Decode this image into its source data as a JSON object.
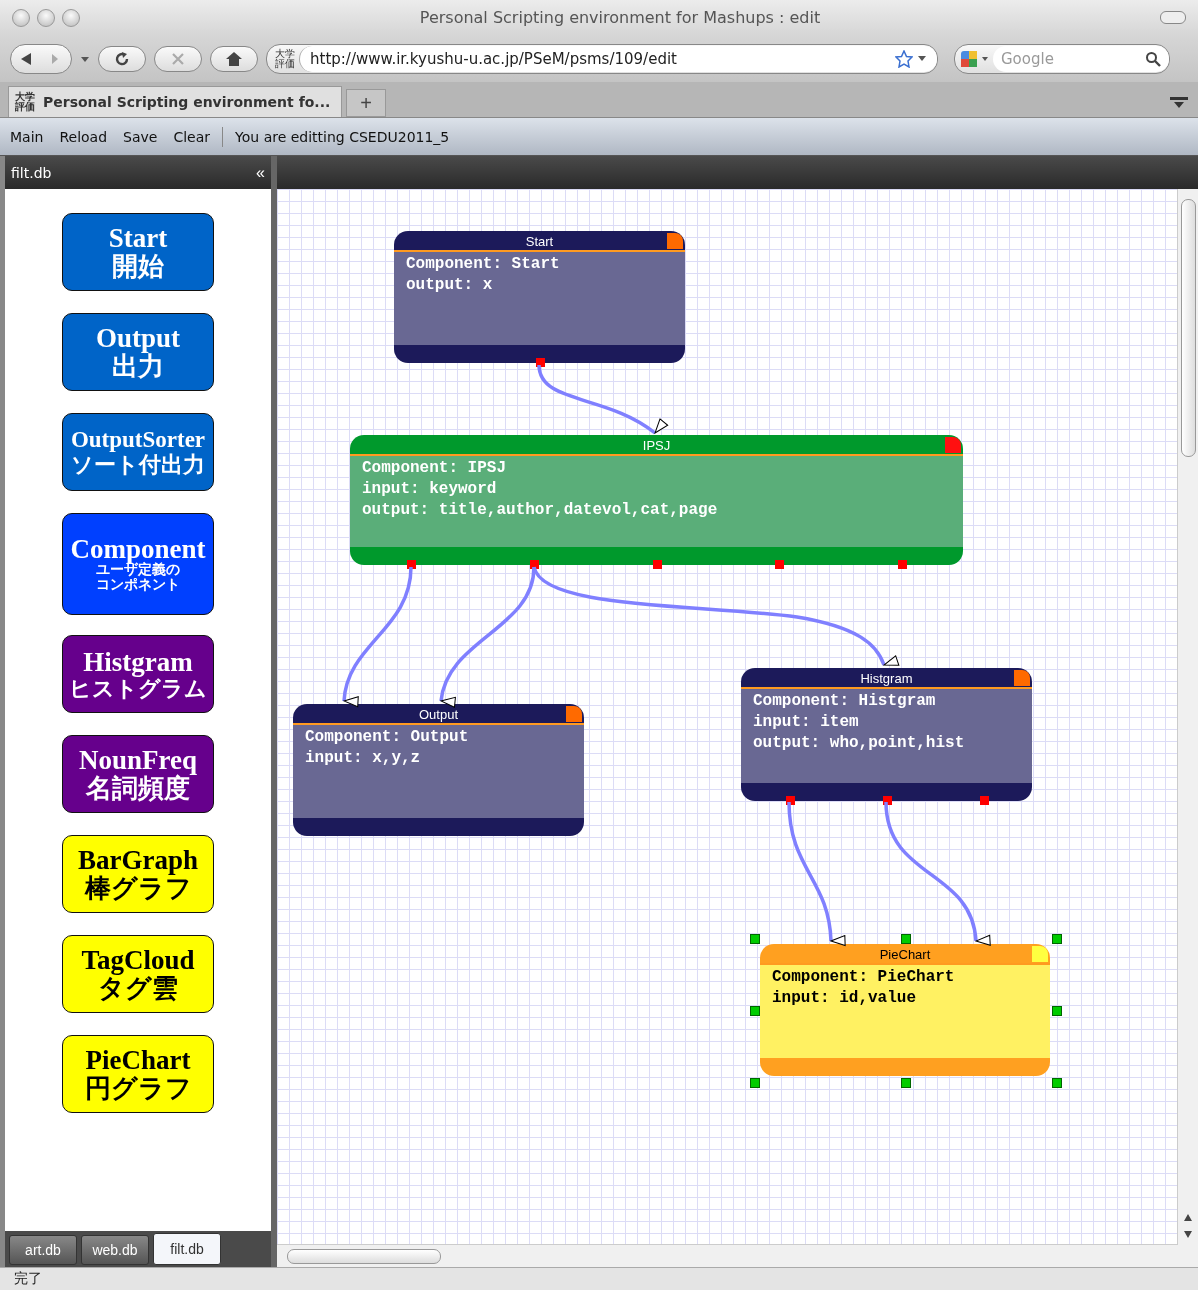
{
  "window": {
    "title": "Personal Scripting environment for Mashups : edit"
  },
  "toolbar": {
    "url": "http://www.ir.kyushu-u.ac.jp/PSeM/psms/109/edit",
    "site_badge": [
      "大学",
      "評価"
    ],
    "search": {
      "placeholder": "Google"
    }
  },
  "tabs": [
    {
      "label": "Personal Scripting environment fo...",
      "selected": true,
      "badge": [
        "大学",
        "評価"
      ]
    }
  ],
  "new_tab": "+",
  "app_menu": {
    "items": [
      "Main",
      "Reload",
      "Save",
      "Clear"
    ],
    "status": "You are editting CSEDU2011_5"
  },
  "palette": {
    "title": "filt.db",
    "collapse": "«",
    "items": [
      {
        "name": "Start",
        "subtitle": "開始",
        "color": "#0064c8"
      },
      {
        "name": "Output",
        "subtitle": "出力",
        "color": "#0064c8"
      },
      {
        "name": "OutputSorter",
        "subtitle": "ソート付出力",
        "color": "#0064c8"
      },
      {
        "name": "Component",
        "subtitle": "ユーザ定義のコンポネント",
        "color": "#0040ff"
      },
      {
        "name": "Histgram",
        "subtitle": "ヒストグラム",
        "color": "#66008c"
      },
      {
        "name": "NounFreq",
        "subtitle": "名詞頻度",
        "color": "#66008c"
      },
      {
        "name": "BarGraph",
        "subtitle": "棒グラフ",
        "color": "#ffff00"
      },
      {
        "name": "TagCloud",
        "subtitle": "タグ雲",
        "color": "#ffff00"
      },
      {
        "name": "PieChart",
        "subtitle": "円グラフ",
        "color": "#ffff00"
      }
    ],
    "tabs": [
      {
        "label": "art.db",
        "selected": false
      },
      {
        "label": "web.db",
        "selected": false
      },
      {
        "label": "filt.db",
        "selected": true
      }
    ]
  },
  "canvas": {
    "nodes": [
      {
        "title": "Start",
        "color": "#1c1a5a",
        "selected": false,
        "lines": [
          "Component: Start",
          "output: x"
        ]
      },
      {
        "title": "IPSJ",
        "color": "#00992c",
        "selected": false,
        "lines": [
          "Component: IPSJ",
          "input: keyword",
          "output: title,author,datevol,cat,page"
        ]
      },
      {
        "title": "Output",
        "color": "#1c1a5a",
        "selected": false,
        "lines": [
          "Component: Output",
          "input: x,y,z"
        ]
      },
      {
        "title": "Histgram",
        "color": "#1c1a5a",
        "selected": false,
        "lines": [
          "Component: Histgram",
          "input: item",
          "output: who,point,hist"
        ]
      },
      {
        "title": "PieChart",
        "color": "#ffa020",
        "selected": true,
        "lines": [
          "Component: PieChart",
          "input: id,value"
        ]
      }
    ]
  },
  "status_bar": {
    "text": "完了"
  }
}
